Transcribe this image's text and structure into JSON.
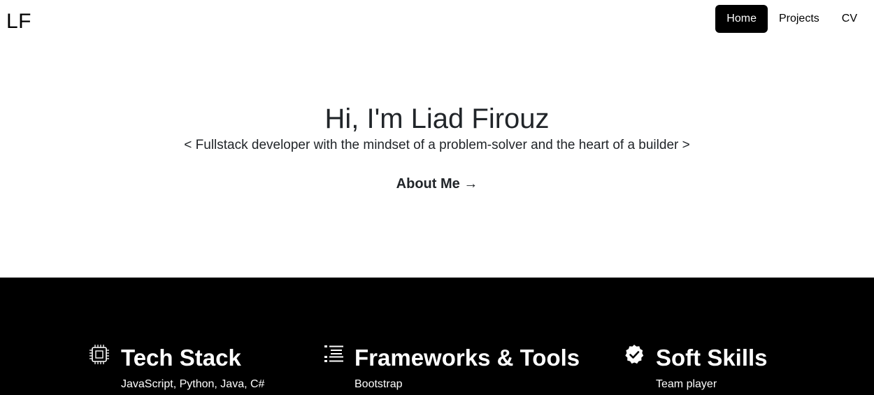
{
  "nav": {
    "brand": "LF",
    "links": [
      {
        "label": "Home",
        "active": true
      },
      {
        "label": "Projects",
        "active": false
      },
      {
        "label": "CV",
        "active": false
      }
    ]
  },
  "hero": {
    "title": "Hi, I'm Liad Firouz",
    "tagline": "< Fullstack developer with the mindset of a problem-solver and the heart of a builder >",
    "about_link": "About Me →"
  },
  "skills": [
    {
      "icon": "cpu-icon",
      "title": "Tech Stack",
      "items": [
        "JavaScript, Python, Java, C#"
      ]
    },
    {
      "icon": "list-icon",
      "title": "Frameworks & Tools",
      "items": [
        "Bootstrap"
      ]
    },
    {
      "icon": "check-badge-icon",
      "title": "Soft Skills",
      "items": [
        "Team player"
      ]
    }
  ],
  "colors": {
    "accent": "#000000",
    "text": "#212529",
    "section_bg": "#000000"
  }
}
